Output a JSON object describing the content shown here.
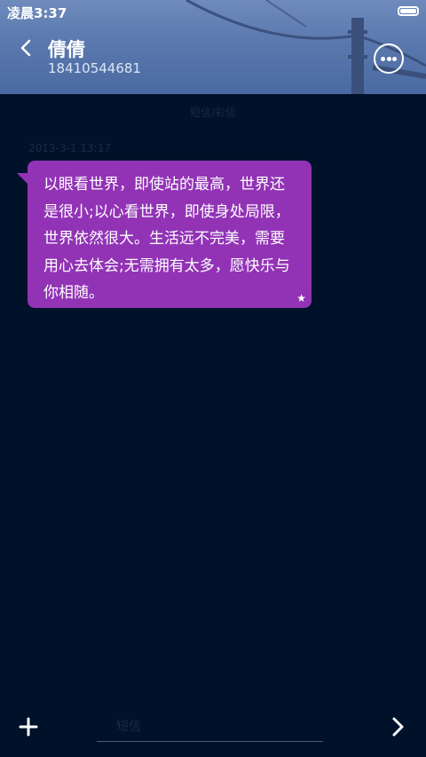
{
  "status_bar": {
    "time": "凌晨3:37"
  },
  "header": {
    "contact_name": "倩倩",
    "contact_number": "18410544681",
    "back_icon": "chevron-left-icon",
    "more_icon": "more-dots-icon"
  },
  "conversation": {
    "day_label": "短信/彩信",
    "messages": [
      {
        "time": "2013-3-1 13:17",
        "text": "以眼看世界，即使站的最高，世界还是很小;以心看世界，即使身处局限，世界依然很大。生活远不完美，需要用心去体会;无需拥有太多，愿快乐与你相随。",
        "starred": true
      }
    ]
  },
  "composer": {
    "placeholder": "短信",
    "add_icon": "plus-icon",
    "send_icon": "chevron-right-icon"
  },
  "colors": {
    "background": "#00112a",
    "bubble": "#9233b6",
    "header": "#5a78ad"
  }
}
